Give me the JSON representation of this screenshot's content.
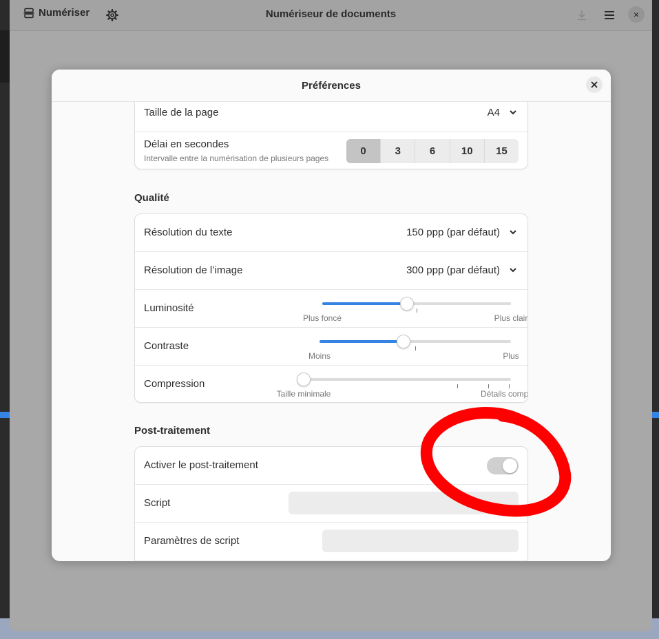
{
  "window": {
    "title": "Numériseur de documents",
    "scan_label": "Numériser"
  },
  "dialog": {
    "title": "Préférences",
    "close_glyph": "×"
  },
  "page_size": {
    "label": "Taille de la page",
    "value": "A4"
  },
  "delay": {
    "label": "Délai en secondes",
    "subtitle": "Intervalle entre la numérisation de plusieurs pages",
    "options": [
      "0",
      "3",
      "6",
      "10",
      "15"
    ],
    "selected": "0"
  },
  "quality": {
    "title": "Qualité",
    "text_resolution": {
      "label": "Résolution du texte",
      "value": "150 ppp (par défaut)"
    },
    "image_resolution": {
      "label": "Résolution de l’image",
      "value": "300 ppp (par défaut)"
    },
    "brightness": {
      "label": "Luminosité",
      "min_label": "Plus foncé",
      "max_label": "Plus clair",
      "level": 0.45
    },
    "contrast": {
      "label": "Contraste",
      "min_label": "Moins",
      "max_label": "Plus",
      "level": 0.44
    },
    "compression": {
      "label": "Compression",
      "min_label": "Taille minimale",
      "max_label": "Détails complets",
      "level": 0.0
    }
  },
  "postprocessing": {
    "title": "Post-traitement",
    "enable": {
      "label": "Activer le post-traitement",
      "enabled": false
    },
    "script": {
      "label": "Script",
      "value": ""
    },
    "script_params": {
      "label": "Paramètres de script",
      "value": ""
    }
  },
  "colors": {
    "accent": "#3584e4",
    "annotation": "#ff0000"
  },
  "icons": {
    "scan": "scanner-icon",
    "settings": "gear-icon",
    "download": "download-icon",
    "menu": "hamburger-menu-icon",
    "close": "close-icon",
    "dropdown": "chevron-down-icon"
  }
}
